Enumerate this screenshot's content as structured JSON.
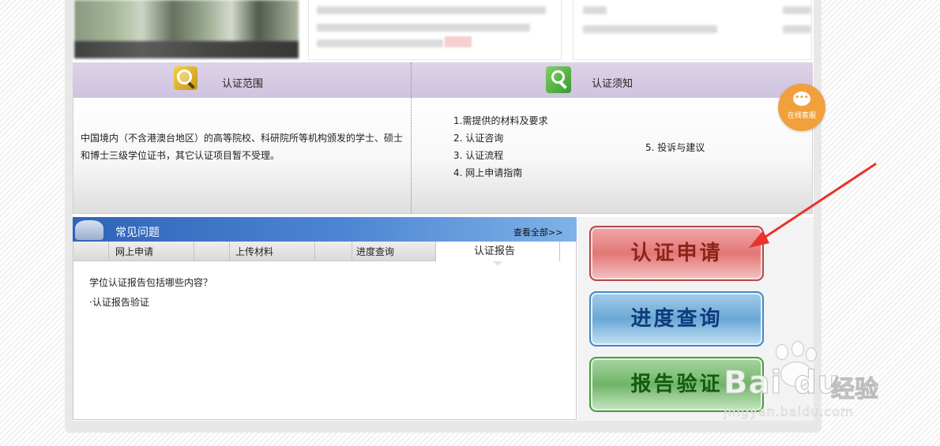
{
  "scope": {
    "title": "认证范围",
    "body": "中国境内（不含港澳台地区）的高等院校、科研院所等机构颁发的学士、硕士和博士三级学位证书，其它认证项目暂不受理。"
  },
  "notice": {
    "title": "认证须知",
    "items": [
      "1.需提供的材料及要求",
      "2. 认证咨询",
      "3. 认证流程",
      "4. 网上申请指南"
    ],
    "extra": "5. 投诉与建议"
  },
  "chat": {
    "label": "在线客服",
    "icon": "chat-bubble-icon"
  },
  "faq": {
    "title": "常见问题",
    "more": "查看全部>>",
    "tabs": [
      "网上申请",
      "上传材料",
      "进度查询",
      "认证报告"
    ],
    "active_tab": "认证报告",
    "question": "学位认证报告包括哪些内容？",
    "answer": "·认证报告验证"
  },
  "actions": {
    "apply": "认证申请",
    "progress": "进度查询",
    "verify": "报告验证"
  },
  "watermark": {
    "brand": "Bai du",
    "cn": "经验",
    "url": "jingyan.baidu.com"
  },
  "colors": {
    "header_purple": "#d6cce5",
    "faq_blue": "#3b6fc0",
    "apply_red": "#e37777",
    "progress_blue": "#6aa8d6",
    "verify_green": "#6fb468",
    "chat_orange": "#f1a03e",
    "annotation_arrow": "#e8322a"
  }
}
